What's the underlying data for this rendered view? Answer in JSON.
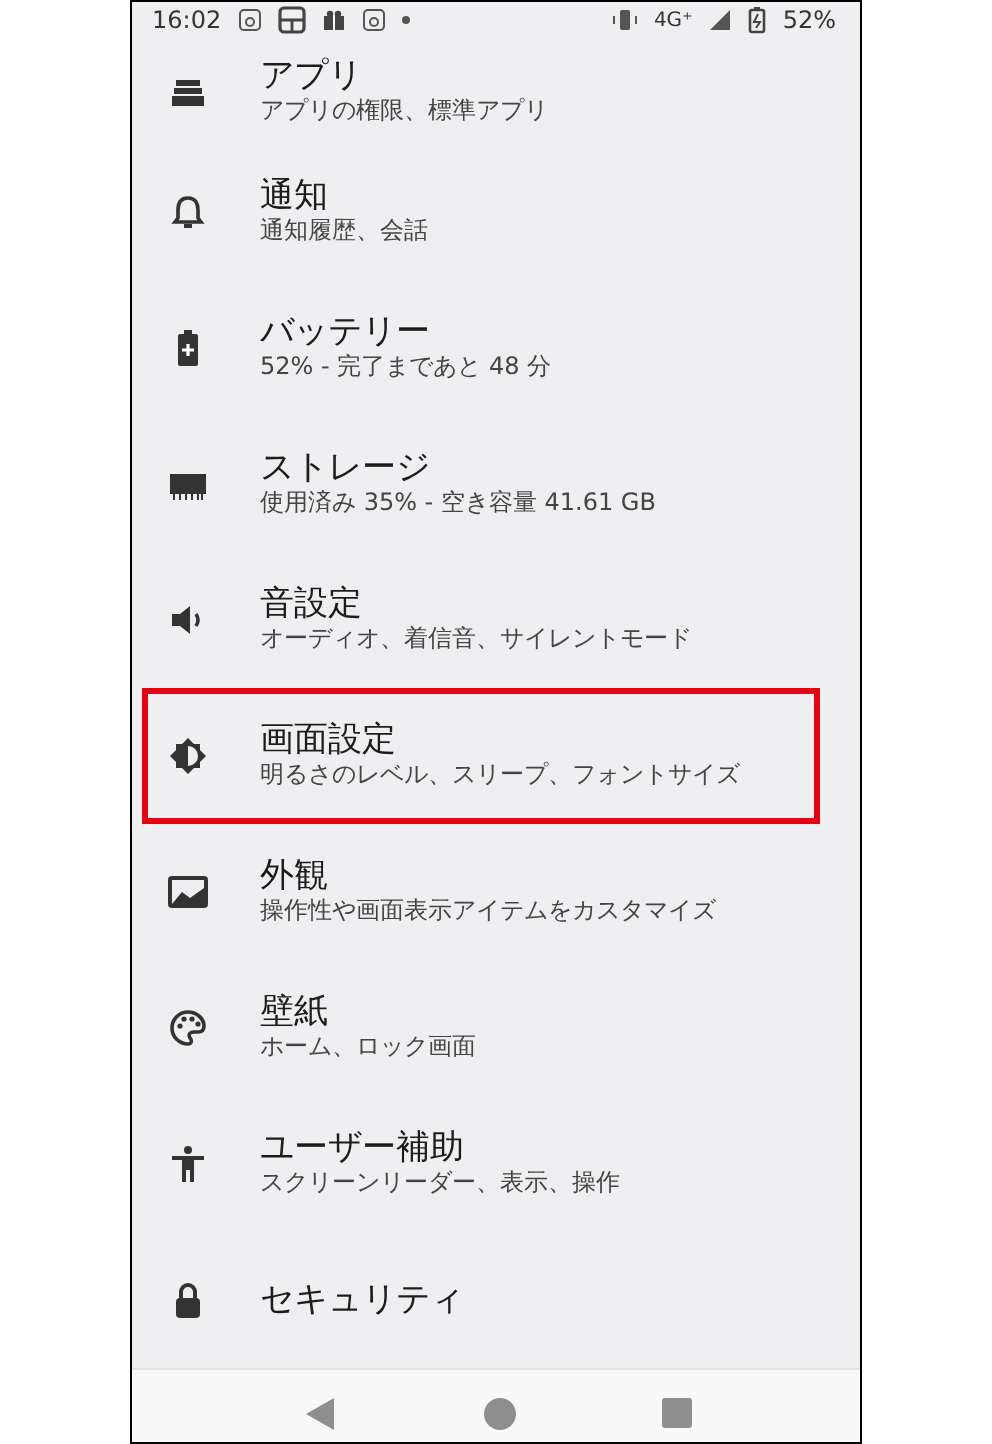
{
  "status_bar": {
    "time": "16:02",
    "network": "4G⁺",
    "battery": "52%"
  },
  "settings": [
    {
      "title": "アプリ",
      "subtitle": "アプリの権限、標準アプリ",
      "selected": false
    },
    {
      "title": "通知",
      "subtitle": "通知履歴、会話",
      "selected": false
    },
    {
      "title": "バッテリー",
      "subtitle": "52% - 完了まであと 48 分",
      "selected": false
    },
    {
      "title": "ストレージ",
      "subtitle": "使用済み 35% - 空き容量 41.61 GB",
      "selected": false
    },
    {
      "title": "音設定",
      "subtitle": "オーディオ、着信音、サイレントモード",
      "selected": false
    },
    {
      "title": "画面設定",
      "subtitle": "明るさのレベル、スリープ、フォントサイズ",
      "selected": true
    },
    {
      "title": "外観",
      "subtitle": "操作性や画面表示アイテムをカスタマイズ",
      "selected": false
    },
    {
      "title": "壁紙",
      "subtitle": "ホーム、ロック画面",
      "selected": false
    },
    {
      "title": "ユーザー補助",
      "subtitle": "スクリーンリーダー、表示、操作",
      "selected": false
    },
    {
      "title": "セキュリティ",
      "selected": false
    }
  ]
}
